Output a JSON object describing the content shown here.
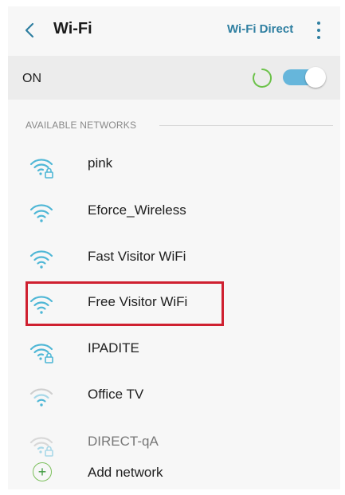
{
  "header": {
    "title": "Wi-Fi",
    "wifi_direct_label": "Wi-Fi Direct"
  },
  "status": {
    "label": "ON",
    "toggle_on": true
  },
  "section": {
    "title": "AVAILABLE NETWORKS"
  },
  "networks": [
    {
      "name": "pink",
      "secured": true
    },
    {
      "name": "Eforce_Wireless",
      "secured": false
    },
    {
      "name": "Fast Visitor WiFi",
      "secured": false
    },
    {
      "name": "Free Visitor WiFi",
      "secured": false,
      "highlighted": true
    },
    {
      "name": "IPADITE",
      "secured": true
    },
    {
      "name": "Office TV",
      "secured": false
    },
    {
      "name": "DIRECT-qA",
      "secured": true
    }
  ],
  "add_network": {
    "label": "Add network",
    "icon": "plus-icon"
  },
  "colors": {
    "accent": "#2f7fa1",
    "toggle": "#66b6db",
    "spinner": "#6cc24a",
    "wifi_icon": "#4fb7d6",
    "highlight": "#cf2030"
  }
}
